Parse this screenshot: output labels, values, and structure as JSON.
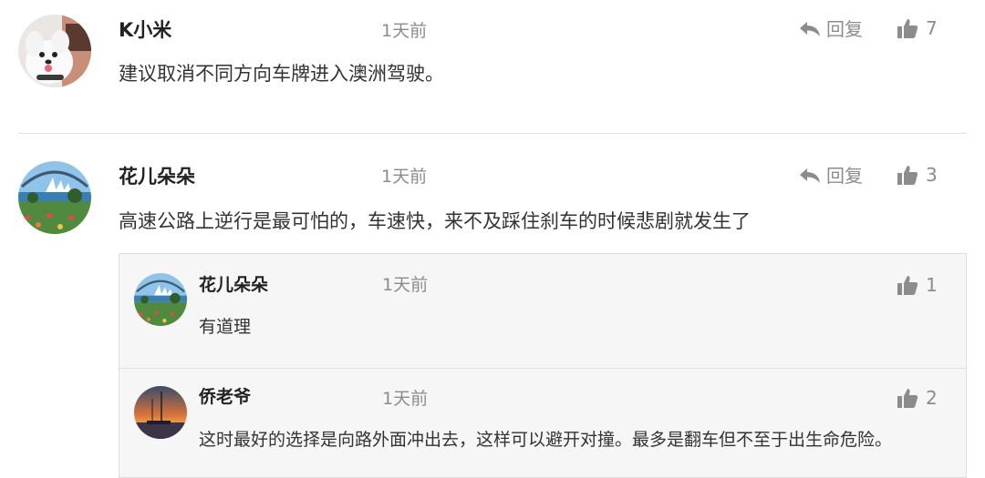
{
  "colors": {
    "meta_gray": "#8c8c8c",
    "subcomment_bg": "#f6f6f6",
    "divider": "#e3e3e3"
  },
  "comments": [
    {
      "username": "K小米",
      "time": "1天前",
      "reply_label": "回复",
      "likes": "7",
      "content": "建议取消不同方向车牌进入澳洲驾驶。",
      "avatar_icon": "white-dog-avatar"
    },
    {
      "username": "花儿朵朵",
      "time": "1天前",
      "reply_label": "回复",
      "likes": "3",
      "content": "高速公路上逆行是最可怕的，车速快，来不及踩住刹车的时候悲剧就发生了",
      "avatar_icon": "sydney-opera-house-avatar",
      "replies": [
        {
          "username": "花儿朵朵",
          "time": "1天前",
          "likes": "1",
          "content": "有道理",
          "avatar_icon": "sydney-opera-house-avatar"
        },
        {
          "username": "侨老爷",
          "time": "1天前",
          "likes": "2",
          "content": "这时最好的选择是向路外面冲出去，这样可以避开对撞。最多是翻车但不至于出生命危险。",
          "avatar_icon": "sunset-harbor-avatar"
        }
      ]
    }
  ]
}
